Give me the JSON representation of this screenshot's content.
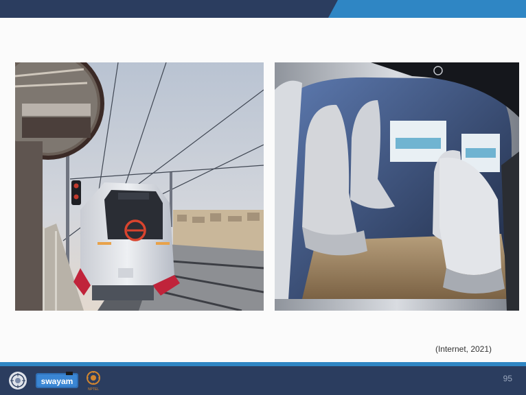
{
  "slide": {
    "caption": "(Internet, 2021)",
    "page_number": "95"
  },
  "images": {
    "left": {
      "depicts": "metro-train-photo"
    },
    "right": {
      "depicts": "autonomous-car-interior-photo"
    }
  },
  "footer": {
    "logos": [
      "emblem-logo",
      "swayam-logo",
      "nptel-logo"
    ],
    "logo_texts": {
      "swayam": "swayam",
      "nptel": "NPTEL"
    }
  },
  "colors": {
    "top_band": "#2b3d5f",
    "accent": "#2f86c4",
    "footer": "#2b3d5f",
    "page_number": "#9aa7bd"
  }
}
